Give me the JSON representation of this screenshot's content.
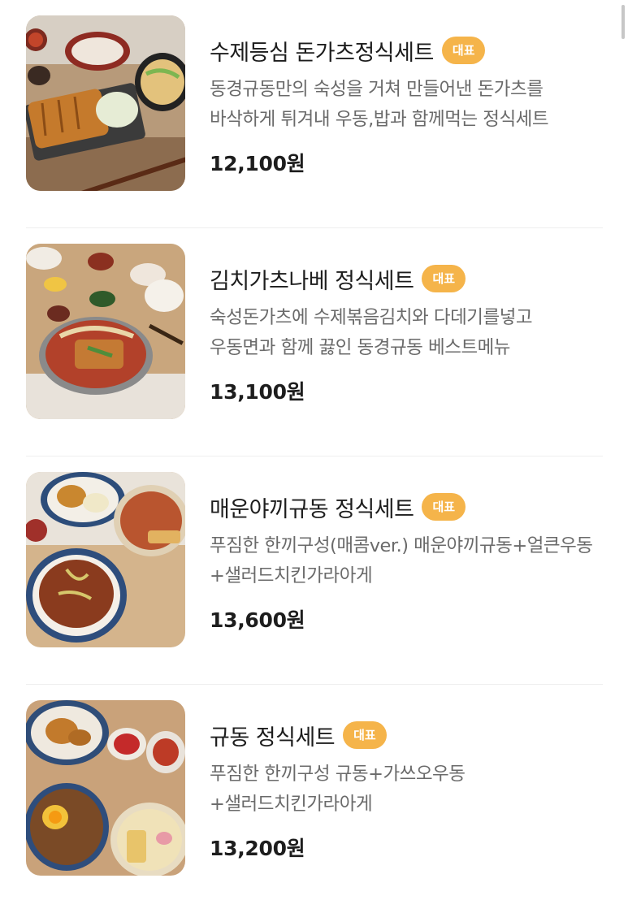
{
  "menu": {
    "badge_label": "대표",
    "items": [
      {
        "title": "수제등심 돈가츠정식세트",
        "description": "동경규동만의 숙성을 거쳐 만들어낸 돈가츠를 바삭하게 튀겨내 우동,밥과 함께먹는 정식세트",
        "price": "12,100원",
        "image": "tonkatsu-set-photo"
      },
      {
        "title": "김치가츠나베 정식세트",
        "description": "숙성돈가츠에 수제볶음김치와 다데기를넣고 우동면과 함께 끓인 동경규동 베스트메뉴",
        "price": "13,100원",
        "image": "kimchi-katsu-nabe-photo"
      },
      {
        "title": "매운야끼규동 정식세트",
        "description": "푸짐한 한끼구성(매콤ver.) 매운야끼규동+얼큰우동+샐러드치킨가라아게",
        "price": "13,600원",
        "image": "spicy-yaki-gyudon-photo"
      },
      {
        "title": "규동 정식세트",
        "description": "푸짐한 한끼구성 규동+가쓰오우동+샐러드치킨가라아게",
        "price": "13,200원",
        "image": "gyudon-set-photo"
      }
    ]
  },
  "colors": {
    "badge": "#f5b44a",
    "title": "#1d1d1d",
    "description": "#6a6a6a",
    "divider": "#efefef"
  }
}
